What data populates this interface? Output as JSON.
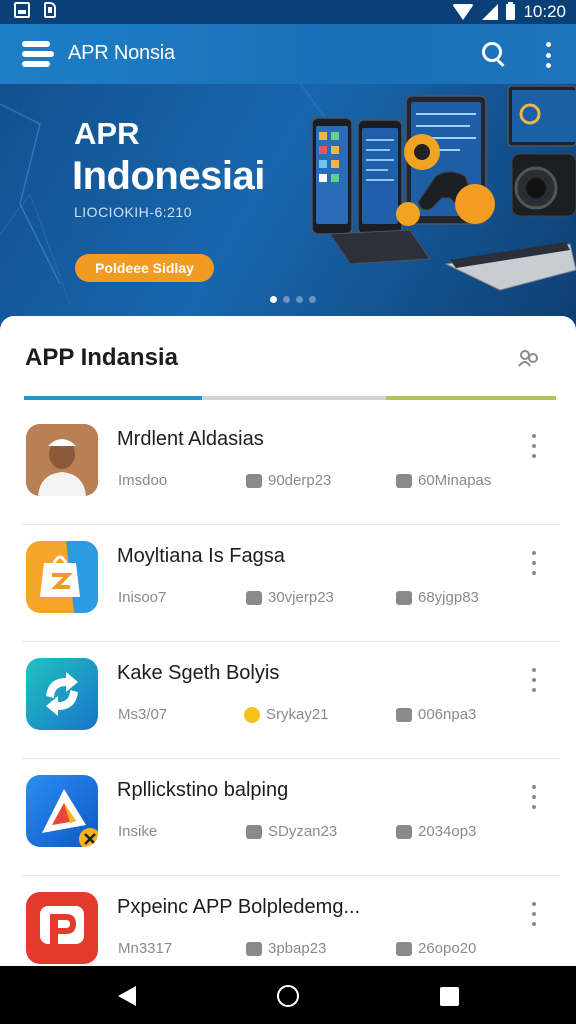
{
  "status_bar": {
    "time": "10:20"
  },
  "app_bar": {
    "title": "APR Nonsia"
  },
  "hero": {
    "title_line1": "APR",
    "title_line2": "Indonesiai",
    "subtitle": "LIOCIOKIH-6:210",
    "cta_label": "Poldeee Sidlay",
    "active_slide": 1,
    "slide_count": 4
  },
  "section": {
    "title": "APP Indansia"
  },
  "apps": [
    {
      "title": "Mrdlent Aldasias",
      "meta": "Imsdoo",
      "stat1": "90derp23",
      "stat2": "60Minapas",
      "icon": "person-photo-icon"
    },
    {
      "title": "Moyltiana Is Fagsa",
      "meta": "Inisoo7",
      "stat1": "30vjerp23",
      "stat2": "68yjgp83",
      "icon": "shopping-bag-icon"
    },
    {
      "title": "Kake Sgeth Bolyis",
      "meta": "Ms3/07",
      "stat1": "Srykay21",
      "stat2": "006npa3",
      "icon": "sync-arrows-icon"
    },
    {
      "title": "Rpllickstino balping",
      "meta": "Insike",
      "stat1": "SDyzan23",
      "stat2": "2034op3",
      "icon": "play-triangle-icon"
    },
    {
      "title": "Pxpeinc APP Bolpledemg...",
      "meta": "Mn3317",
      "stat1": "3pbap23",
      "stat2": "26opo20",
      "icon": "p-letter-icon"
    }
  ]
}
